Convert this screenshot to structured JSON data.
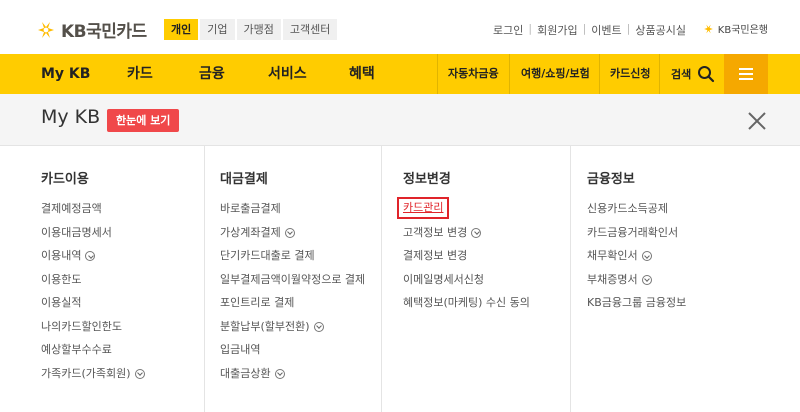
{
  "brand": {
    "logo_text": "KB국민카드",
    "accent": "#ffcc00",
    "accent_dark": "#f5a800",
    "badge_red": "#f0484a"
  },
  "segment_tabs": [
    "개인",
    "기업",
    "가맹점",
    "고객센터"
  ],
  "util_links": [
    "로그인",
    "회원가입",
    "이벤트",
    "상품공시실"
  ],
  "bank_link": "KB국민은행",
  "nav": {
    "main": [
      "My KB",
      "카드",
      "금융",
      "서비스",
      "혜택"
    ],
    "sub": [
      "자동차금융",
      "여행/쇼핑/보험",
      "카드신청"
    ],
    "search_label": "검색"
  },
  "panel": {
    "title": "My KB",
    "summary_button": "한눈에 보기",
    "columns": [
      {
        "title": "카드이용",
        "items": [
          {
            "label": "결제예정금액",
            "chevron": false
          },
          {
            "label": "이용대금명세서",
            "chevron": false
          },
          {
            "label": "이용내역",
            "chevron": true
          },
          {
            "label": "이용한도",
            "chevron": false
          },
          {
            "label": "이용실적",
            "chevron": false
          },
          {
            "label": "나의카드할인한도",
            "chevron": false
          },
          {
            "label": "예상할부수수료",
            "chevron": false
          },
          {
            "label": "가족카드(가족회원)",
            "chevron": true
          }
        ]
      },
      {
        "title": "대금결제",
        "items": [
          {
            "label": "바로출금결제",
            "chevron": false
          },
          {
            "label": "가상계좌결제",
            "chevron": true
          },
          {
            "label": "단기카드대출로 결제",
            "chevron": false
          },
          {
            "label": "일부결제금액이월약정으로 결제",
            "chevron": false
          },
          {
            "label": "포인트리로 결제",
            "chevron": false
          },
          {
            "label": "분할납부(할부전환)",
            "chevron": true
          },
          {
            "label": "입금내역",
            "chevron": false
          },
          {
            "label": "대출금상환",
            "chevron": true
          }
        ]
      },
      {
        "title": "정보변경",
        "items": [
          {
            "label": "카드관리",
            "chevron": false,
            "highlighted": true
          },
          {
            "label": "고객정보 변경",
            "chevron": true
          },
          {
            "label": "결제정보 변경",
            "chevron": false
          },
          {
            "label": "이메일명세서신청",
            "chevron": false
          },
          {
            "label": "혜택정보(마케팅) 수신 동의",
            "chevron": false
          }
        ]
      },
      {
        "title": "금융정보",
        "items": [
          {
            "label": "신용카드소득공제",
            "chevron": false
          },
          {
            "label": "카드금융거래확인서",
            "chevron": false
          },
          {
            "label": "채무확인서",
            "chevron": true
          },
          {
            "label": "부채증명서",
            "chevron": true
          },
          {
            "label": "KB금융그룹 금융정보",
            "chevron": false
          }
        ]
      }
    ]
  }
}
